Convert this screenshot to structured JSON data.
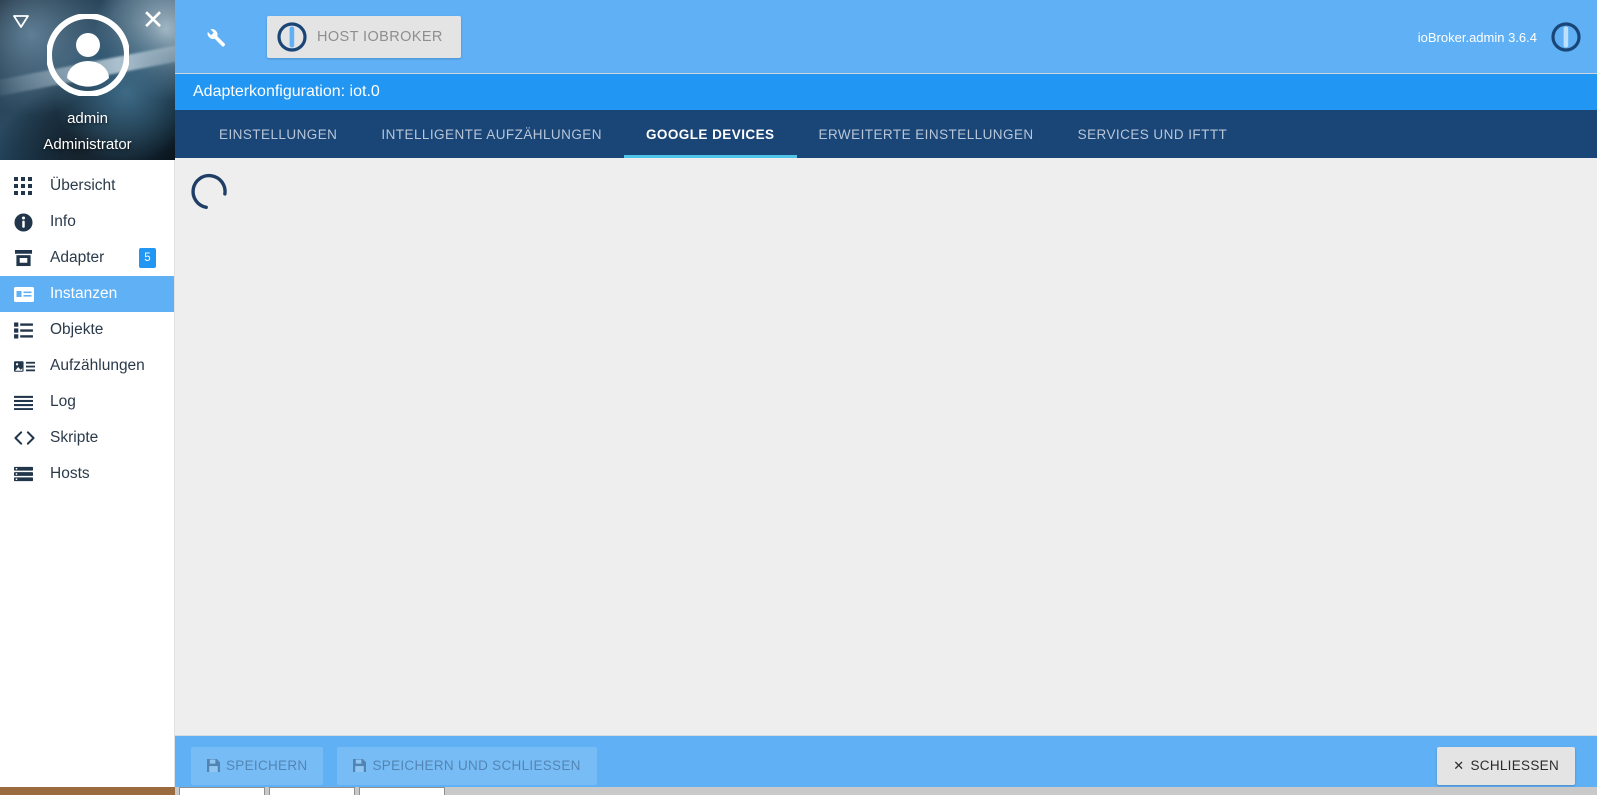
{
  "sidebar": {
    "collapse_icon": "triangle-down-icon",
    "close_icon": "close-icon",
    "avatar_icon": "user-avatar-icon",
    "user_name": "admin",
    "user_role": "Administrator",
    "items": [
      {
        "label": "Übersicht",
        "icon": "grid-icon",
        "selected": false,
        "badge": null
      },
      {
        "label": "Info",
        "icon": "info-icon",
        "selected": false,
        "badge": null
      },
      {
        "label": "Adapter",
        "icon": "store-icon",
        "selected": false,
        "badge": "5"
      },
      {
        "label": "Instanzen",
        "icon": "card-icon",
        "selected": true,
        "badge": null
      },
      {
        "label": "Objekte",
        "icon": "list-icon",
        "selected": false,
        "badge": null
      },
      {
        "label": "Aufzählungen",
        "icon": "enum-icon",
        "selected": false,
        "badge": null
      },
      {
        "label": "Log",
        "icon": "lines-icon",
        "selected": false,
        "badge": null
      },
      {
        "label": "Skripte",
        "icon": "code-icon",
        "selected": false,
        "badge": null
      },
      {
        "label": "Hosts",
        "icon": "server-icon",
        "selected": false,
        "badge": null
      }
    ]
  },
  "topbar": {
    "wrench_icon": "wrench-icon",
    "host_logo_icon": "iobroker-logo-icon",
    "host_label": "HOST IOBROKER",
    "version": "ioBroker.admin 3.6.4",
    "power_icon": "power-icon"
  },
  "config": {
    "title": "Adapterkonfiguration: iot.0",
    "tabs": [
      {
        "label": "EINSTELLUNGEN",
        "active": false
      },
      {
        "label": "INTELLIGENTE AUFZÄHLUNGEN",
        "active": false
      },
      {
        "label": "GOOGLE DEVICES",
        "active": true
      },
      {
        "label": "ERWEITERTE EINSTELLUNGEN",
        "active": false
      },
      {
        "label": "SERVICES UND IFTTT",
        "active": false
      }
    ],
    "content_state": "loading-spinner"
  },
  "bottombar": {
    "save_label": "SPEICHERN",
    "save_close_label": "SPEICHERN UND SCHLIESSEN",
    "close_label": "SCHLIESSEN",
    "save_icon": "floppy-disk-icon",
    "close_icon": "close-x-icon"
  },
  "colors": {
    "header_blue": "#5FB0F5",
    "title_blue": "#2196F3",
    "tabbar_navy": "#1A4577",
    "tab_underline": "#4FC3E8",
    "content_bg": "#EEEEEE",
    "badge_blue": "#2196F3",
    "spinner": "#1F3E66"
  }
}
